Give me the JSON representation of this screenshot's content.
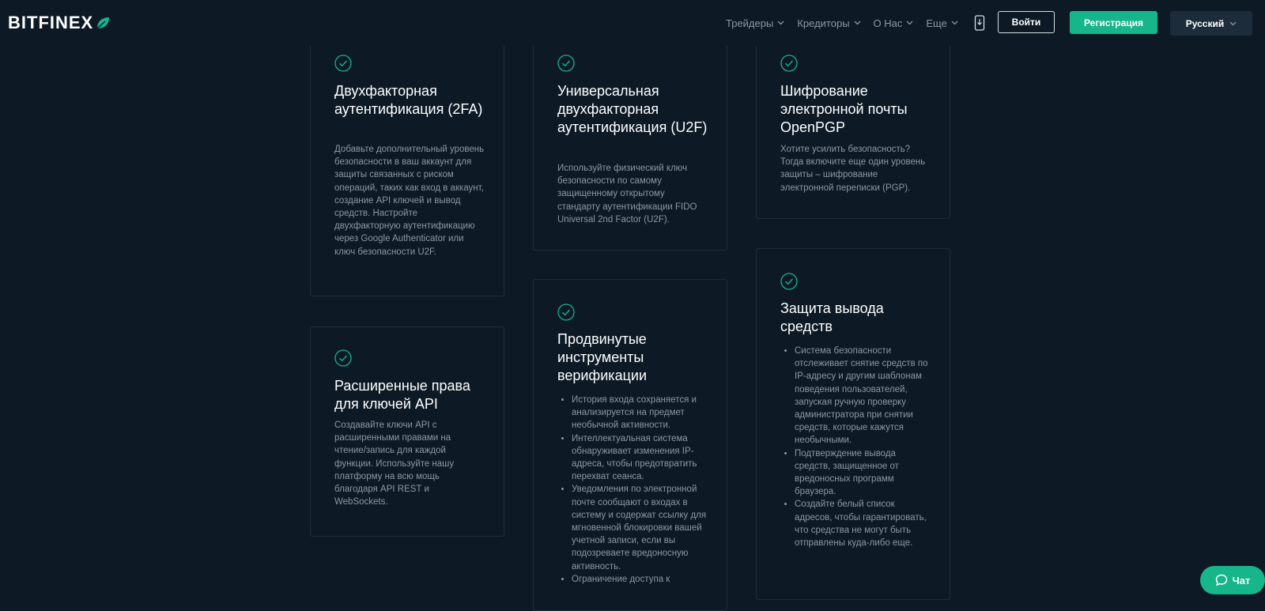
{
  "header": {
    "logo_text": "BITFINEX",
    "nav": [
      {
        "label": "Трейдеры"
      },
      {
        "label": "Кредиторы"
      },
      {
        "label": "О Нас"
      },
      {
        "label": "Еще"
      }
    ],
    "login_label": "Войти",
    "register_label": "Регистрация",
    "language_label": "Русский"
  },
  "cards": [
    {
      "title": "Двухфакторная аутентификация (2FA)",
      "description": "Добавьте дополнительный уровень безопасности в ваш аккаунт для защиты связанных с риском операций, таких как вход в аккаунт, создание API ключей и вывод средств. Настройте двухфакторную аутентификацию через Google Authenticator или ключ безопасности U2F."
    },
    {
      "title": "Универсальная двухфакторная аутентификация (U2F)",
      "description": "Используйте физический ключ безопасности по самому защищенному открытому стандарту аутентификации FIDO Universal 2nd Factor (U2F)."
    },
    {
      "title": "Шифрование электронной почты OpenPGP",
      "description": "Хотите усилить безопасность? Тогда включите еще один уровень защиты – шифрование электронной переписки (PGP)."
    },
    {
      "title": "Расширенные права для ключей API",
      "description": "Создавайте ключи API с расширенными правами на чтение/запись для каждой функции. Используйте нашу платформу на всю мощь благодаря API REST и WebSockets."
    },
    {
      "title": "Продвинутые инструменты верификации",
      "items": [
        "История входа сохраняется и анализируется на предмет необычной активности.",
        "Интеллектуальная система обнаруживает изменения IP-адреса, чтобы предотвратить перехват сеанса.",
        "Уведомления по электронной почте сообщают о входах в систему и содержат ссылку для мгновенной блокировки вашей учетной записи, если вы подозреваете вредоносную активность.",
        "Ограничение доступа к"
      ]
    },
    {
      "title": "Защита вывода средств",
      "items": [
        "Система безопасности отслеживает снятие средств по IP-адресу и другим шаблонам поведения пользователей, запуская ручную проверку администратора при снятии средств, которые кажутся необычными.",
        "Подтверждение вывода средств, защищенное от вредоносных программ браузера.",
        "Создайте белый список адресов, чтобы гарантировать, что средства не могут быть отправлены куда-либо еще."
      ]
    }
  ],
  "chat_label": "Чат",
  "colors": {
    "background": "#0d1a26",
    "accent": "#16b68a",
    "card_border": "#1f2d3b",
    "muted_text": "#8a98a6"
  }
}
